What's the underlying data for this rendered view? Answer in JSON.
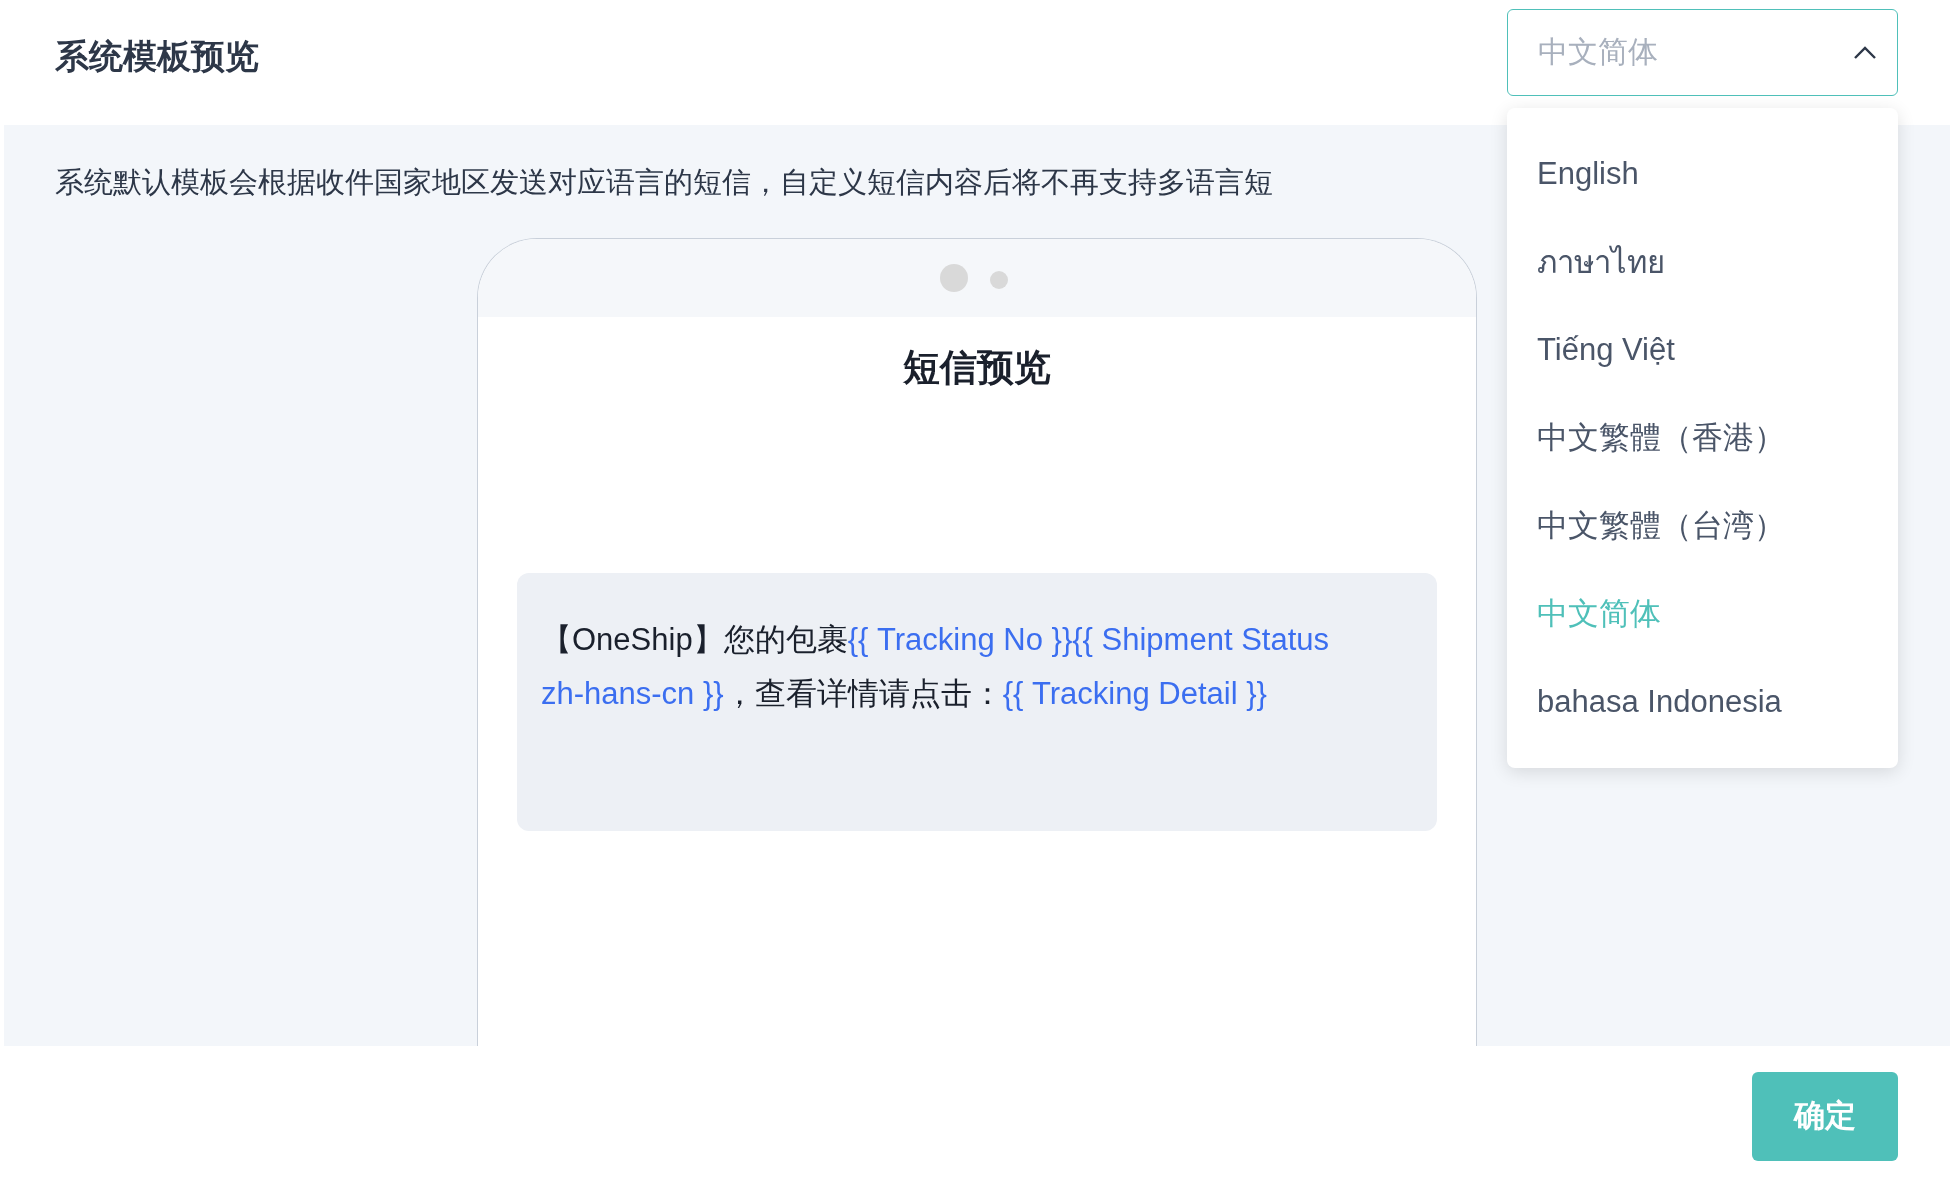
{
  "header": {
    "title": "系统模板预览"
  },
  "language_select": {
    "value": "中文简体",
    "expanded": true,
    "options": [
      {
        "label": "English",
        "selected": false
      },
      {
        "label": "ภาษาไทย",
        "selected": false
      },
      {
        "label": "Tiếng Việt",
        "selected": false
      },
      {
        "label": "中文繁體（香港）",
        "selected": false
      },
      {
        "label": "中文繁體（台湾）",
        "selected": false
      },
      {
        "label": "中文简体",
        "selected": true
      },
      {
        "label": "bahasa Indonesia",
        "selected": false
      }
    ]
  },
  "description": "系统默认模板会根据收件国家地区发送对应语言的短信，自定义短信内容后将不再支持多语言短",
  "phone": {
    "title": "短信预览",
    "message": [
      {
        "kind": "text",
        "text": "【OneShip】您的包裹"
      },
      {
        "kind": "variable",
        "text": "{{ Tracking No }}"
      },
      {
        "kind": "variable",
        "text": "{{ Shipment Status zh-hans-cn }}"
      },
      {
        "kind": "text",
        "text": "，查看详情请点击："
      },
      {
        "kind": "variable",
        "text": "{{ Tracking Detail }}"
      }
    ]
  },
  "buttons": [
    {
      "label": "确定"
    }
  ]
}
